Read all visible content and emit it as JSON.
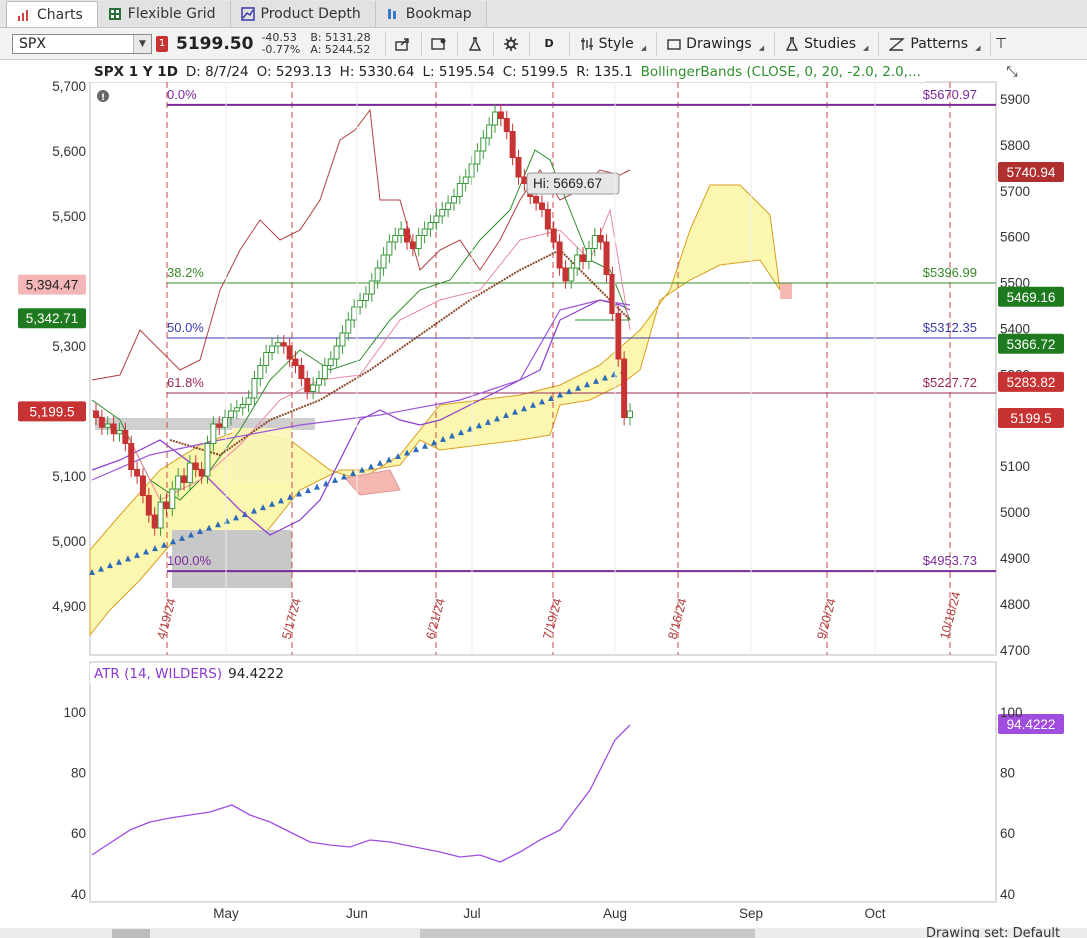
{
  "tabs": [
    {
      "label": "Charts",
      "icon": "bar-chart-icon",
      "active": true
    },
    {
      "label": "Flexible Grid",
      "icon": "grid-icon",
      "active": false
    },
    {
      "label": "Product Depth",
      "icon": "depth-chart-icon",
      "active": false
    },
    {
      "label": "Bookmap",
      "icon": "bookmap-icon",
      "active": false
    }
  ],
  "toolbar": {
    "symbol": "SPX",
    "alert_count": "1",
    "last": "5199.50",
    "change": "-40.53",
    "change_pct": "-0.77%",
    "bid": "B: 5131.28",
    "ask": "A: 5244.52",
    "aggregation": "D",
    "style_label": "Style",
    "drawings_label": "Drawings",
    "studies_label": "Studies",
    "patterns_label": "Patterns"
  },
  "info": {
    "symbol_period": "SPX 1 Y 1D",
    "date": "D: 8/7/24",
    "open": "O: 5293.13",
    "high": "H: 5330.64",
    "low": "L: 5195.54",
    "close": "C: 5199.5",
    "range": "R: 135.1",
    "study": "BollingerBands (CLOSE, 0, 20, -2.0, 2.0,..."
  },
  "axes": {
    "left_ticks": [
      "5,700",
      "5,600",
      "5,500",
      "5,400",
      "5,300",
      "5,200",
      "5,100",
      "5,000",
      "4,900"
    ],
    "right_ticks": [
      "5900",
      "5800",
      "5700",
      "5600",
      "5500",
      "5400",
      "5300",
      "5200",
      "5100",
      "5000",
      "4900",
      "4800",
      "4700"
    ],
    "atr_ticks_left": [
      "100",
      "80",
      "60",
      "40"
    ],
    "atr_ticks_right": [
      "100",
      "80",
      "60",
      "40"
    ],
    "months": [
      "May",
      "Jun",
      "Jul",
      "Aug",
      "Sep",
      "Oct"
    ]
  },
  "left_badges": [
    {
      "text": "5,394.47",
      "price": 5394.47,
      "color": "#f4b6b6",
      "text_color": "#222"
    },
    {
      "text": "5,342.71",
      "price": 5342.71,
      "color": "#1e7a1e",
      "text_color": "#fff"
    },
    {
      "text": "5,199.5",
      "price": 5199.5,
      "color": "#c73232",
      "text_color": "#fff"
    }
  ],
  "right_badges": [
    {
      "text": "5740.94",
      "price": 5740.94,
      "color": "#b03030",
      "text_color": "#fff"
    },
    {
      "text": "5469.16",
      "price": 5469.16,
      "color": "#1e7a1e",
      "text_color": "#fff"
    },
    {
      "text": "5366.72",
      "price": 5366.72,
      "color": "#1e7a1e",
      "text_color": "#fff"
    },
    {
      "text": "5283.82",
      "price": 5283.82,
      "color": "#c73232",
      "text_color": "#fff"
    },
    {
      "text": "5199.5",
      "price": 5199.5,
      "color": "#c73232",
      "text_color": "#fff"
    },
    {
      "text": "94.4222",
      "atr": 94.4222,
      "color": "#a04de0",
      "text_color": "#fff"
    }
  ],
  "fib_levels": [
    {
      "pct": "0.0%",
      "value": "$5670.97",
      "price": 5670.97,
      "color": "#7a2a9a"
    },
    {
      "pct": "38.2%",
      "value": "$5396.99",
      "price": 5396.99,
      "color": "#3a8a2a"
    },
    {
      "pct": "50.0%",
      "value": "$5312.35",
      "price": 5312.35,
      "color": "#3a3aaa"
    },
    {
      "pct": "61.8%",
      "value": "$5227.72",
      "price": 5227.72,
      "color": "#9a2a5a"
    },
    {
      "pct": "100.0%",
      "value": "$4953.73",
      "price": 4953.73,
      "color": "#7a2a9a"
    }
  ],
  "date_markers": [
    "4/19/24",
    "5/17/24",
    "6/21/24",
    "7/19/24",
    "8/16/24",
    "9/20/24",
    "10/18/24"
  ],
  "hi_label": "Hi: 5669.67",
  "atr": {
    "name": "ATR (14, WILDERS)",
    "value": "94.4222"
  },
  "drawing_set": "Drawing set: Default",
  "colors": {
    "up": "#3c9a3c",
    "down": "#c73232",
    "fib_purple": "#7a2a9a",
    "cloud_yellow": "#fbf6b0",
    "cloud_red": "#f5b8b0",
    "dashed_red": "#c84a4a",
    "trend_blue": "#2a6ab8",
    "atr_purple": "#a04de0"
  },
  "chart_data": {
    "type": "candlestick",
    "closes": [
      5190,
      5175,
      5180,
      5165,
      5170,
      5150,
      5110,
      5100,
      5070,
      5040,
      5020,
      5060,
      5050,
      5080,
      5100,
      5090,
      5120,
      5110,
      5100,
      5150,
      5180,
      5175,
      5190,
      5200,
      5205,
      5210,
      5220,
      5250,
      5270,
      5290,
      5300,
      5305,
      5300,
      5280,
      5270,
      5250,
      5230,
      5240,
      5250,
      5270,
      5280,
      5300,
      5320,
      5340,
      5360,
      5370,
      5380,
      5400,
      5420,
      5440,
      5460,
      5470,
      5480,
      5460,
      5450,
      5470,
      5480,
      5490,
      5500,
      5510,
      5520,
      5530,
      5550,
      5560,
      5580,
      5600,
      5620,
      5640,
      5660,
      5650,
      5630,
      5590,
      5560,
      5550,
      5530,
      5520,
      5510,
      5480,
      5460,
      5420,
      5400,
      5420,
      5440,
      5430,
      5450,
      5470,
      5460,
      5410,
      5350,
      5280,
      5190,
      5200
    ]
  }
}
